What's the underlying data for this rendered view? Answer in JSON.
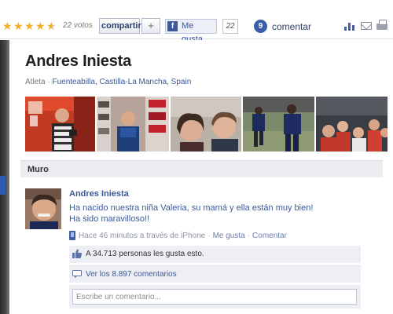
{
  "toolbar": {
    "rating": 4.5,
    "votes_label": "22 votos",
    "share_label": "compartir",
    "plus_label": "+",
    "fb_icon_letter": "f",
    "like_label": "Me gusta",
    "like_count": "22",
    "comment_count": "9",
    "comment_label": "comentar",
    "icons": [
      "stats-icon",
      "mail-icon",
      "print-icon"
    ]
  },
  "profile": {
    "name": "Andres Iniesta",
    "category": "Atleta",
    "separator": "·",
    "location": "Fuenteabilla, Castilla-La Mancha, Spain"
  },
  "photos_count": 5,
  "wall": {
    "tab_label": "Muro"
  },
  "post": {
    "author": "Andres Iniesta",
    "text": "Ha nacido nuestra niña Valeria, su mamá y ella están muy bien! Ha sido maravilloso!!",
    "time": "Hace 46 minutos a través de iPhone",
    "like_link": "Me gusta",
    "comment_link": "Comentar",
    "likes_text": "A 34.713 personas les gusta esto.",
    "comments_text": "Ver los 8.897 comentarios",
    "comment_placeholder": "Escribe un comentario..."
  },
  "colors": {
    "facebook_blue": "#3b5998",
    "star_gold": "#f2b01e",
    "muro_bar": "#ecedf1",
    "action_box": "#edeff4"
  }
}
